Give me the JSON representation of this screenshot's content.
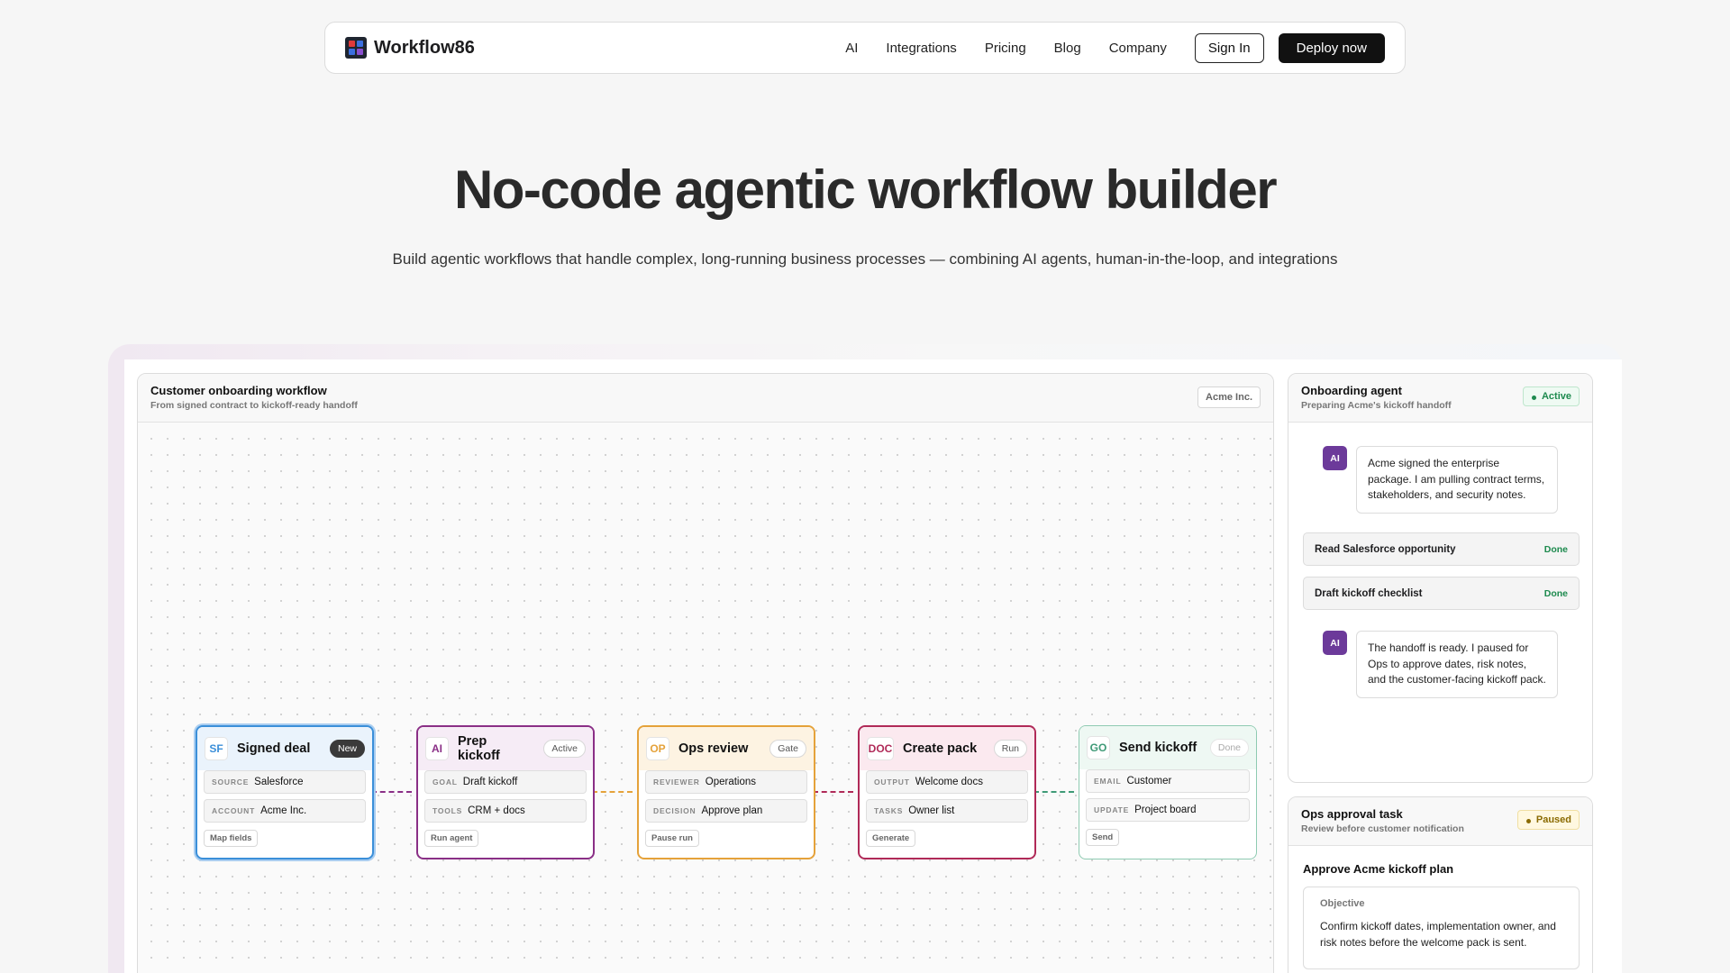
{
  "nav": {
    "brand": "Workflow86",
    "links": [
      "AI",
      "Integrations",
      "Pricing",
      "Blog",
      "Company"
    ],
    "sign_in": "Sign In",
    "deploy": "Deploy now"
  },
  "hero": {
    "title": "No-code agentic workflow builder",
    "subtitle": "Build agentic workflows that handle complex, long-running business processes — combining AI agents, human-in-the-loop, and integrations"
  },
  "canvas": {
    "title": "Customer onboarding workflow",
    "subtitle": "From signed contract to kickoff-ready handoff",
    "tag": "Acme Inc.",
    "nodes": [
      {
        "icon": "SF",
        "title": "Signed deal",
        "badge": "New",
        "fields": [
          {
            "k": "SOURCE",
            "v": "Salesforce"
          },
          {
            "k": "ACCOUNT",
            "v": "Acme Inc."
          }
        ],
        "action": "Map fields"
      },
      {
        "icon": "AI",
        "title": "Prep kickoff",
        "badge": "Active",
        "fields": [
          {
            "k": "GOAL",
            "v": "Draft kickoff"
          },
          {
            "k": "TOOLS",
            "v": "CRM + docs"
          }
        ],
        "action": "Run agent"
      },
      {
        "icon": "OP",
        "title": "Ops review",
        "badge": "Gate",
        "fields": [
          {
            "k": "REVIEWER",
            "v": "Operations"
          },
          {
            "k": "DECISION",
            "v": "Approve plan"
          }
        ],
        "action": "Pause run"
      },
      {
        "icon": "DOC",
        "title": "Create pack",
        "badge": "Run",
        "fields": [
          {
            "k": "OUTPUT",
            "v": "Welcome docs"
          },
          {
            "k": "TASKS",
            "v": "Owner list"
          }
        ],
        "action": "Generate"
      },
      {
        "icon": "GO",
        "title": "Send kickoff",
        "badge": "Done",
        "fields": [
          {
            "k": "EMAIL",
            "v": "Customer"
          },
          {
            "k": "UPDATE",
            "v": "Project board"
          }
        ],
        "action": "Send"
      }
    ]
  },
  "agent": {
    "title": "Onboarding agent",
    "subtitle": "Preparing Acme's kickoff handoff",
    "status": "Active",
    "avatar": "AI",
    "message1": "Acme signed the enterprise package. I am pulling contract terms, stakeholders, and security notes.",
    "steps": [
      {
        "label": "Read Salesforce opportunity",
        "state": "Done"
      },
      {
        "label": "Draft kickoff checklist",
        "state": "Done"
      }
    ],
    "message2": "The handoff is ready. I paused for Ops to approve dates, risk notes, and the customer-facing kickoff pack."
  },
  "task": {
    "title": "Ops approval task",
    "subtitle": "Review before customer notification",
    "status": "Paused",
    "heading": "Approve Acme kickoff plan",
    "objective_label": "Objective",
    "objective_text": "Confirm kickoff dates, implementation owner, and risk notes before the welcome pack is sent."
  },
  "colors": {
    "blue": "#3b8fd9",
    "purple": "#8a2f86",
    "orange": "#e5a23a",
    "crimson": "#b02a58",
    "green": "#3f9a77"
  }
}
